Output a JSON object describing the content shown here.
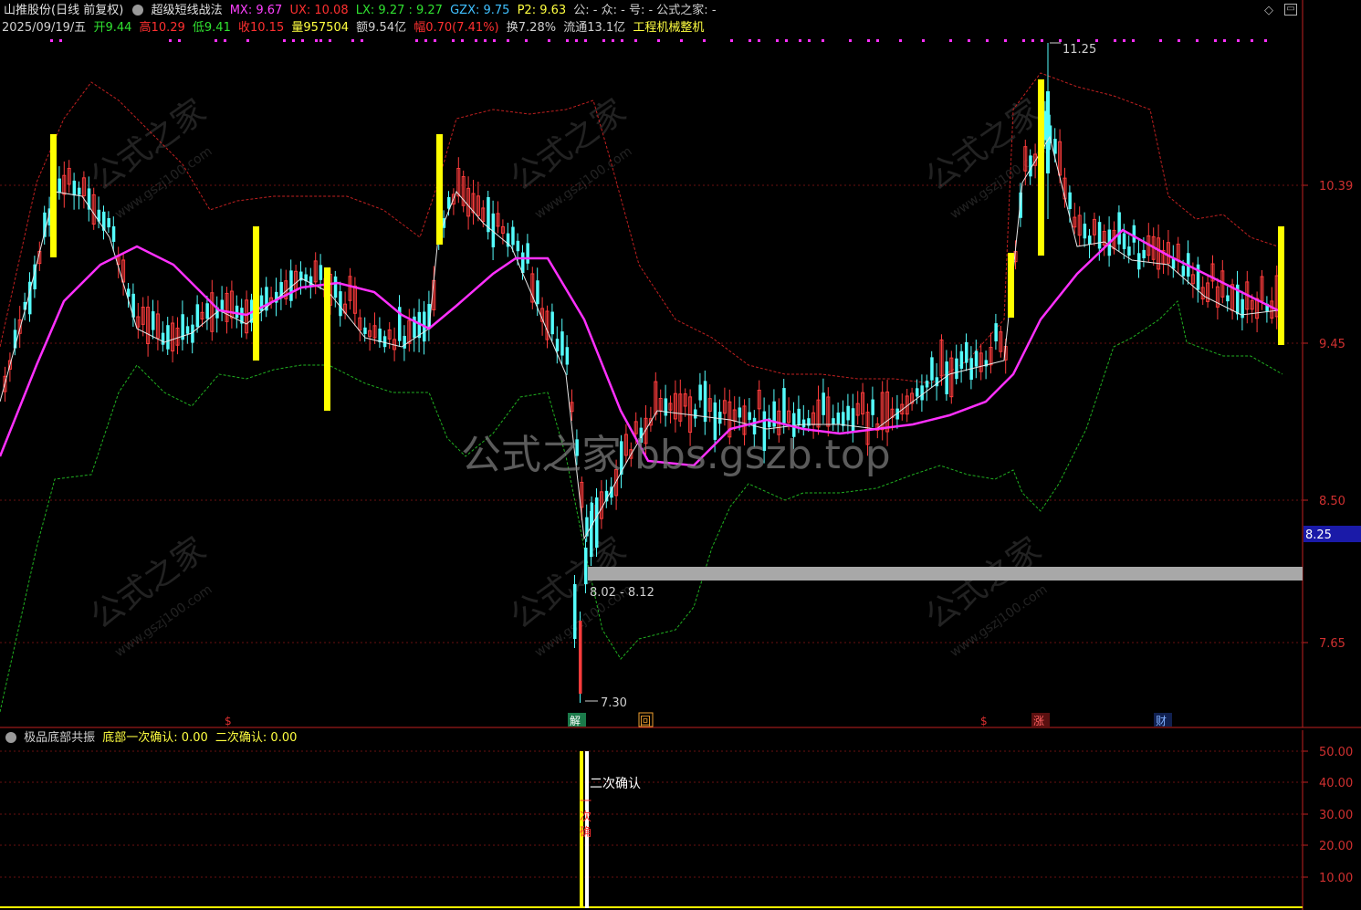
{
  "header1": {
    "stock_name": "山推股份(日线 前复权)",
    "indicator_name": "超级短线战法",
    "mx": "MX: 9.67",
    "ux": "UX: 10.08",
    "lx": "LX: 9.27 : 9.27",
    "gzx": "GZX: 9.75",
    "p2": "P2: 9.63",
    "misc": "公: -  众: -  号: -  公式之家: -"
  },
  "header2": {
    "date": "2025/09/19/五",
    "open": "开9.44",
    "high": "高10.29",
    "low": "低9.41",
    "close": "收10.15",
    "volume": "量957504",
    "amount": "额9.54亿",
    "change": "幅0.70(7.41%)",
    "turnover": "换7.28%",
    "float": "流通13.1亿",
    "industry": "工程机械整机"
  },
  "price_axis": [
    "10.39",
    "9.45",
    "8.50",
    "7.65"
  ],
  "current_price_tag": "8.25",
  "annotations": {
    "high_label": "11.25",
    "low_label": "7.30",
    "zone_label": "8.02 - 8.12",
    "watermark": "公式之家 bbs.gszb.top",
    "side_watermark": "公式之家",
    "side_watermark_url": "www.gszj100.com"
  },
  "markers": [
    {
      "text": "$",
      "color": "#e03030"
    },
    {
      "text": "解",
      "color": "#ffffff",
      "bg": "#1b7a4a"
    },
    {
      "text": "回",
      "color": "#f0a030"
    },
    {
      "text": "$",
      "color": "#e03030"
    },
    {
      "text": "涨",
      "color": "#ff4040"
    },
    {
      "text": "财",
      "color": "#60a0ff"
    }
  ],
  "sub_panel": {
    "name": "极品底部共振",
    "value1": "底部一次确认: 0.00",
    "value2": "二次确认: 0.00",
    "axis": [
      "50.00",
      "40.00",
      "30.00",
      "20.00",
      "10.00"
    ],
    "label_second": "二次确认",
    "label_first": "一次确认"
  },
  "colors": {
    "up": "#ff3c3c",
    "down": "#54fcfc",
    "ma_magenta": "#ff30ff",
    "signal_yellow": "#ffff00",
    "upper_band": "#c02020",
    "lower_band": "#20c020",
    "axis_red": "#c02020"
  },
  "corner_icons": [
    "diamond-icon",
    "restore-icon"
  ]
}
